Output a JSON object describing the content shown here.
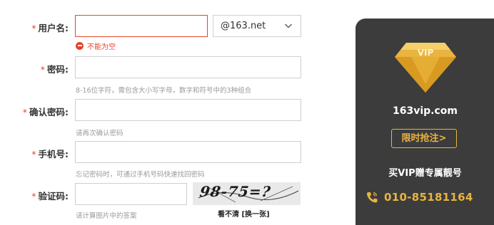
{
  "form": {
    "username": {
      "label": "用户名:",
      "value": "",
      "error": "不能为空"
    },
    "domain": {
      "selected": "@163.net"
    },
    "password": {
      "label": "密码:",
      "hint": "8-16位字符，需包含大小写字母，数字和符号中的3种组合"
    },
    "confirm": {
      "label": "确认密码:",
      "hint": "请再次确认密码"
    },
    "phone": {
      "label": "手机号:",
      "hint": "忘记密码时，可通过手机号码快速找回密码"
    },
    "captcha": {
      "label": "验证码:",
      "hint": "请计算图片中的答案",
      "image_text": "98-75=?",
      "refresh": "看不清 [换一张]"
    },
    "required_mark": "*"
  },
  "vip_panel": {
    "badge_text": "VIP",
    "site": "163vip.com",
    "button": "限时抢注>",
    "slogan": "买VIP赠专属靓号",
    "phone": "010-85181164",
    "colors": {
      "background": "#3c3c3c",
      "accent": "#e9b43f"
    }
  },
  "colors": {
    "error": "#e8432e",
    "hint": "#9a9a9a"
  }
}
